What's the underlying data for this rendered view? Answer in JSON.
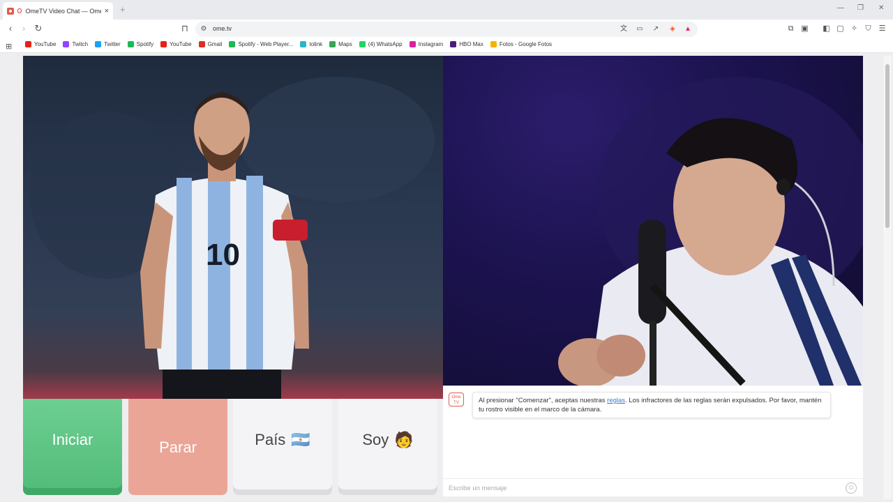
{
  "browser": {
    "tab_title": "OmeTV Video Chat — Omeg",
    "tab_close": "×",
    "new_tab": "+",
    "url": "ome.tv",
    "window_controls": [
      "—",
      "❐",
      "✕"
    ]
  },
  "bookmarks": [
    {
      "label": "YouTube",
      "color": "#e62117"
    },
    {
      "label": "Twitch",
      "color": "#9146ff"
    },
    {
      "label": "Twitter",
      "color": "#1da1f2"
    },
    {
      "label": "Spotify",
      "color": "#1db954"
    },
    {
      "label": "YouTube",
      "color": "#e62117"
    },
    {
      "label": "Gmail",
      "color": "#d93025"
    },
    {
      "label": "Spotify - Web Player...",
      "color": "#1db954"
    },
    {
      "label": "tolink",
      "color": "#2bb6c7"
    },
    {
      "label": "Maps",
      "color": "#34a853"
    },
    {
      "label": "(4) WhatsApp",
      "color": "#25d366"
    },
    {
      "label": "Instagram",
      "color": "#d6249f"
    },
    {
      "label": "HBO Max",
      "color": "#4a1c7e"
    },
    {
      "label": "Fotos - Google Fotos",
      "color": "#f4b400"
    }
  ],
  "controls": {
    "start_label": "Iniciar",
    "stop_label": "Parar",
    "country_label": "País",
    "country_flag": "🇦🇷",
    "gender_label": "Soy",
    "gender_emoji": "🧑"
  },
  "chat": {
    "logo_text": "Ome TV",
    "rules_prefix": "Al presionar \"Comenzar\", aceptas nuestras ",
    "rules_link": "reglas",
    "rules_suffix": ". Los infractores de las reglas serán expulsados. Por favor, mantén tu rostro visible en el marco de la cámara.",
    "input_placeholder": "Escribe un mensaje"
  },
  "colors": {
    "start": "#52bb79",
    "stop": "#eaa596",
    "accent": "#e05a4f"
  }
}
